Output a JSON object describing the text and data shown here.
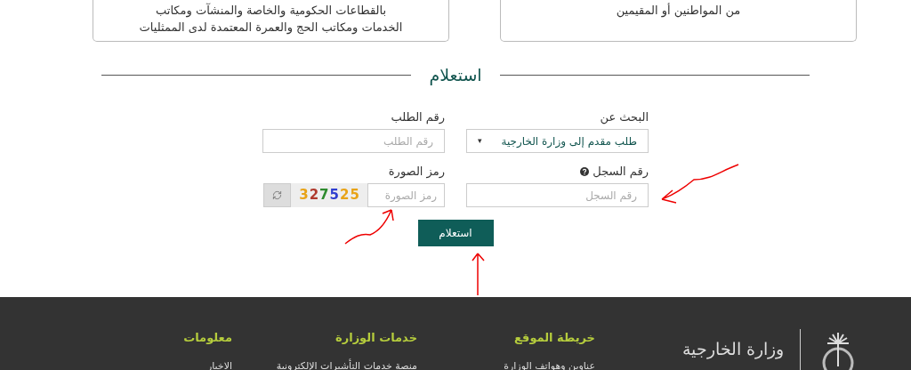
{
  "cards": [
    {
      "lines": [
        "من المواطنين أو المقيمين"
      ]
    },
    {
      "lines": [
        "بالقطاعات الحكومية والخاصة والمنشآت ومكاتب",
        "الخدمات ومكاتب الحج والعمرة المعتمدة لدى الممثليات"
      ]
    }
  ],
  "section_title": "استعلام",
  "form": {
    "search_for": {
      "label": "البحث عن",
      "value": "طلب مقدم إلى وزارة الخارجية",
      "caret": "▾"
    },
    "request_number": {
      "label": "رقم الطلب",
      "placeholder": "رقم الطلب"
    },
    "record_number": {
      "label": "رقم السجل",
      "placeholder": "رقم السجل"
    },
    "captcha": {
      "label": "رمز الصورة",
      "placeholder": "رمز الصورة",
      "digits": [
        {
          "text": "5",
          "color": "#e8a317"
        },
        {
          "text": "2",
          "color": "#e8a317"
        },
        {
          "text": "5",
          "color": "#2f3fd0"
        },
        {
          "text": "7",
          "color": "#2e8b2e"
        },
        {
          "text": "2",
          "color": "#b03a2e"
        },
        {
          "text": "3",
          "color": "#e8a317"
        }
      ]
    },
    "submit": "استعلام"
  },
  "footer": {
    "logo_text": "وزارة الخارجية",
    "columns": [
      {
        "title": "خريطة الموقع",
        "links": [
          "عناوين وهواتف الوزارة"
        ]
      },
      {
        "title": "خدمات الوزارة",
        "links": [
          "منصة خدمات التأشيرات الإلكترونية"
        ]
      },
      {
        "title": "معلومات",
        "links": [
          "الاخبار"
        ]
      }
    ]
  }
}
